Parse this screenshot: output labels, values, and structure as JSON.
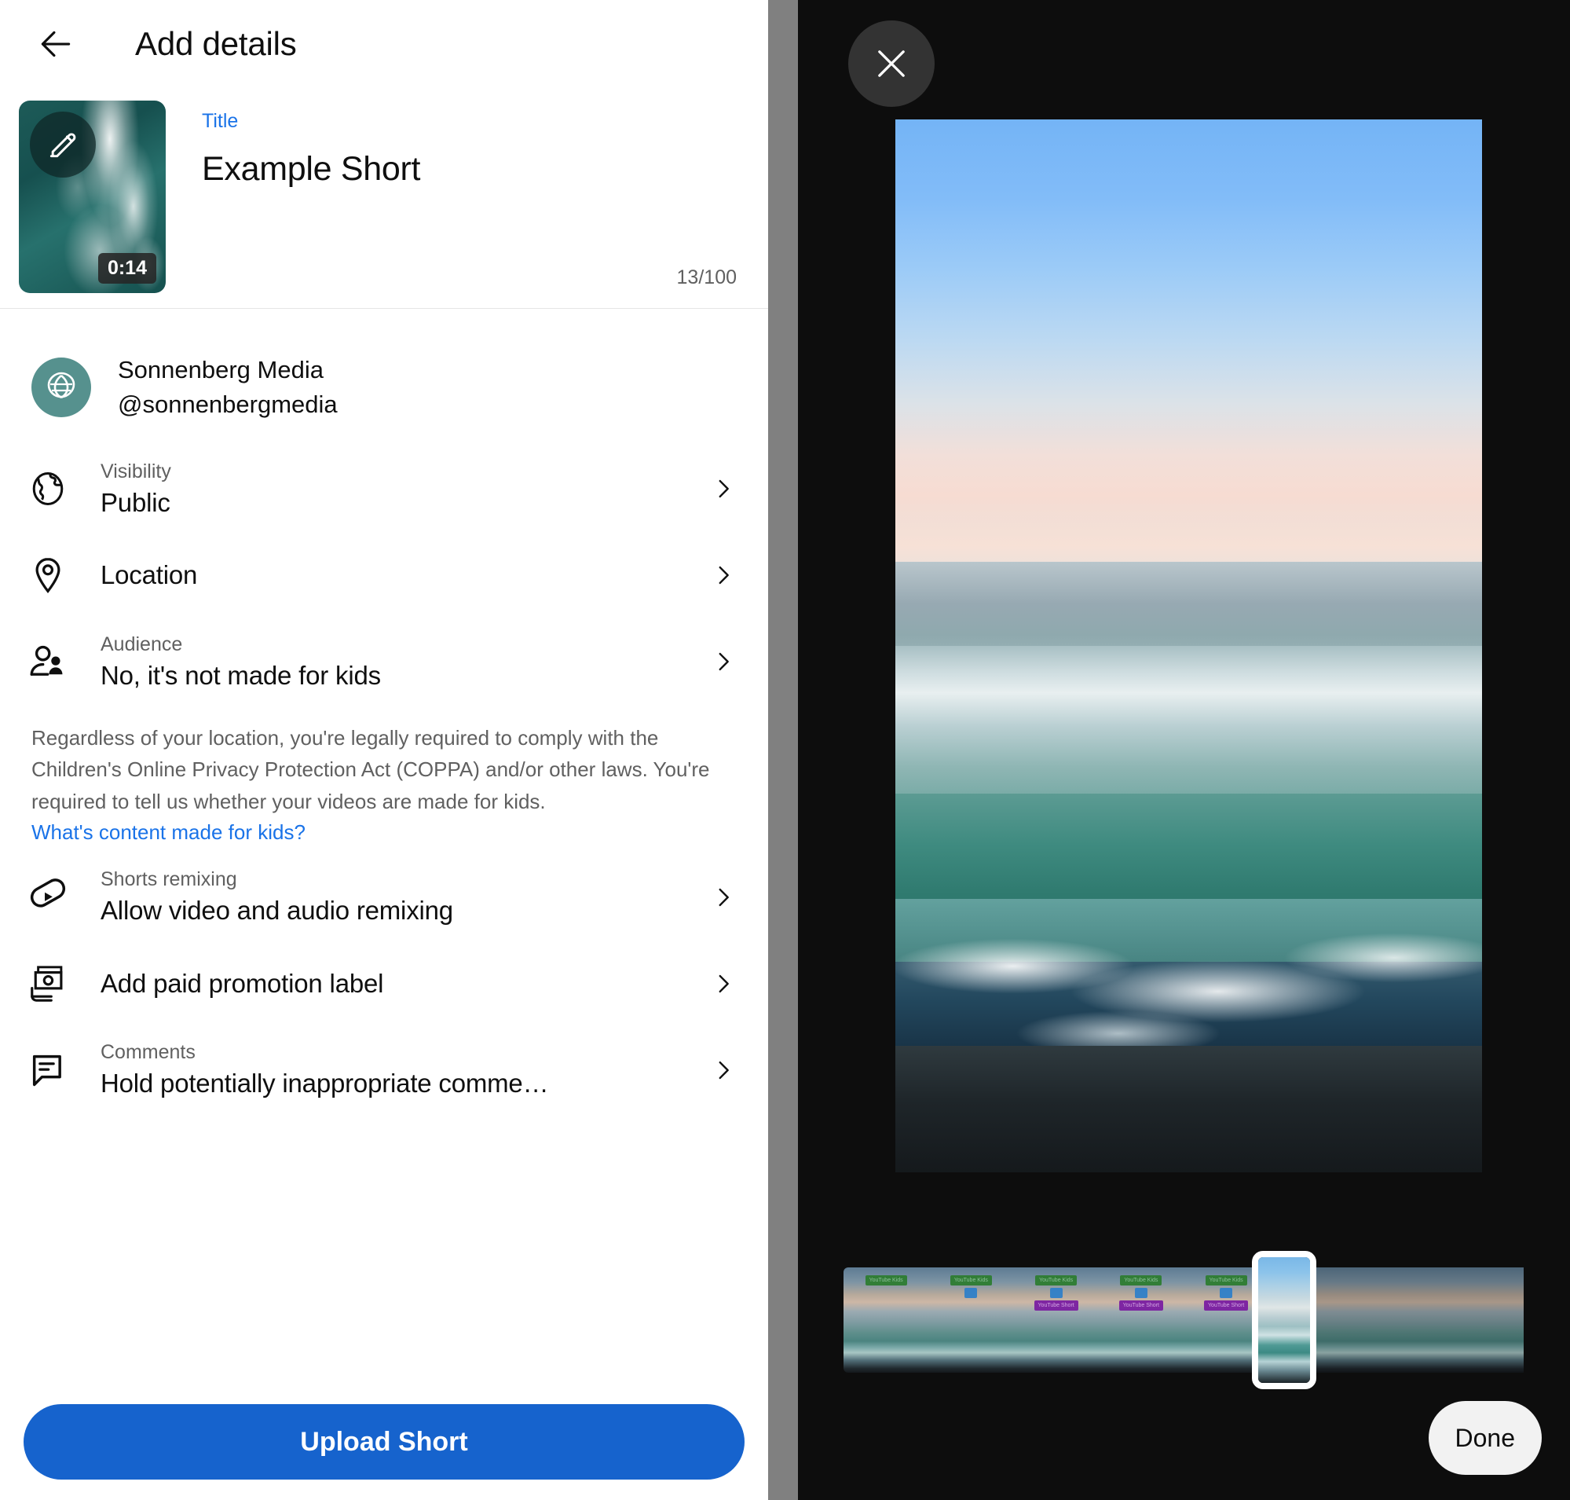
{
  "header": {
    "title": "Add details",
    "back_icon": "arrow-left-icon"
  },
  "video": {
    "thumbnail_edit_icon": "pencil-icon",
    "duration": "0:14"
  },
  "title_field": {
    "label": "Title",
    "value": "Example Short",
    "char_count": "13/100"
  },
  "channel": {
    "avatar_icon": "leaf-logo-icon",
    "name": "Sonnenberg Media",
    "handle": "@sonnenbergmedia"
  },
  "options": [
    {
      "icon": "globe-icon",
      "sub": "Visibility",
      "main": "Public",
      "chevron": "chevron-right-icon"
    },
    {
      "icon": "location-pin-icon",
      "sub": "",
      "main": "Location",
      "chevron": "chevron-right-icon"
    },
    {
      "icon": "audience-people-icon",
      "sub": "Audience",
      "main": "No, it's not made for kids",
      "chevron": "chevron-right-icon"
    }
  ],
  "coppa": {
    "text": "Regardless of your location, you're legally required to comply with the Children's Online Privacy Protection Act (COPPA) and/or other laws. You're required to tell us whether your videos are made for kids.",
    "link": "What's content made for kids?"
  },
  "options2": [
    {
      "icon": "shorts-remix-icon",
      "sub": "Shorts remixing",
      "main": "Allow video and audio remixing",
      "chevron": "chevron-right-icon"
    },
    {
      "icon": "paid-promotion-icon",
      "sub": "",
      "main": "Add paid promotion label",
      "chevron": "chevron-right-icon"
    },
    {
      "icon": "comment-icon",
      "sub": "Comments",
      "main": "Hold potentially inappropriate comme…",
      "chevron": "chevron-right-icon"
    }
  ],
  "upload": {
    "label": "Upload Short"
  },
  "preview": {
    "close_icon": "close-icon",
    "done_label": "Done",
    "frames": [
      {
        "badge_kids": "YouTube Kids",
        "badge_square": true,
        "badge_short": ""
      },
      {
        "badge_kids": "YouTube Kids",
        "badge_square": true,
        "badge_short": ""
      },
      {
        "badge_kids": "YouTube Kids",
        "badge_square": true,
        "badge_short": "YouTube Short"
      },
      {
        "badge_kids": "YouTube Kids",
        "badge_square": true,
        "badge_short": "YouTube Short"
      },
      {
        "badge_kids": "YouTube Kids",
        "badge_square": true,
        "badge_short": "YouTube Short"
      },
      {
        "badge_kids": "",
        "badge_square": false,
        "badge_short": ""
      },
      {
        "badge_kids": "",
        "badge_square": false,
        "badge_short": ""
      },
      {
        "badge_kids": "",
        "badge_square": false,
        "badge_short": ""
      }
    ]
  },
  "colors": {
    "accent_blue": "#1663cd",
    "link_blue": "#1a73e8",
    "avatar_teal": "#56918e",
    "panel_dark": "#0d0d0d",
    "divider_gray": "#808080"
  }
}
